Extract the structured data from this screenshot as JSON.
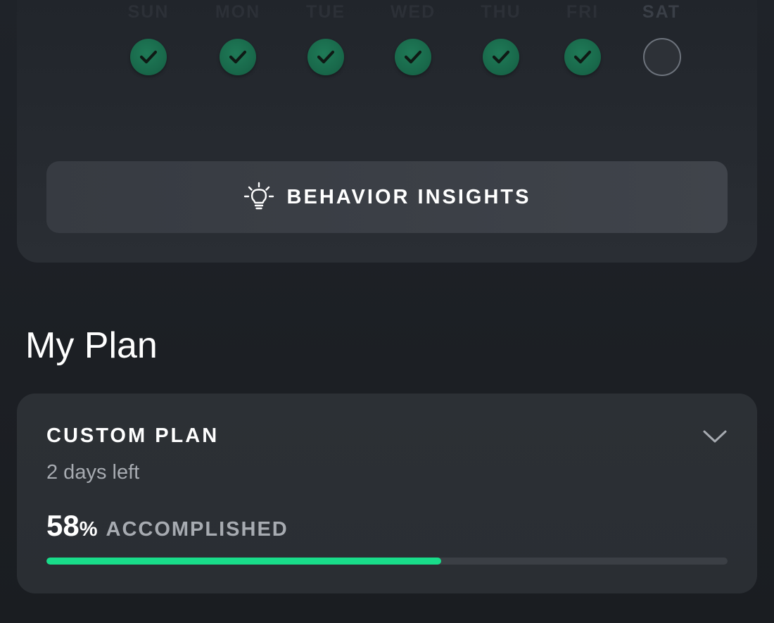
{
  "week": {
    "days": [
      {
        "label": "SUN",
        "done": true
      },
      {
        "label": "MON",
        "done": true
      },
      {
        "label": "TUE",
        "done": true
      },
      {
        "label": "WED",
        "done": true
      },
      {
        "label": "THU",
        "done": true
      },
      {
        "label": "FRI",
        "done": true
      },
      {
        "label": "SAT",
        "done": false
      }
    ],
    "insights_button": {
      "label": "BEHAVIOR INSIGHTS",
      "icon": "lightbulb-icon"
    }
  },
  "my_plan": {
    "title": "My Plan",
    "plan": {
      "name": "CUSTOM PLAN",
      "days_left": "2 days left",
      "percent": "58",
      "percent_sign": "%",
      "accomplished_label": "ACCOMPLISHED",
      "progress_fraction": 0.58,
      "expand_icon": "chevron-down-icon"
    }
  },
  "colors": {
    "accent_green": "#19dc8a",
    "check_green": "#19694b",
    "card_bg": "#2a2e33",
    "button_bg": "#3b3f46",
    "background": "#1c1f24"
  }
}
